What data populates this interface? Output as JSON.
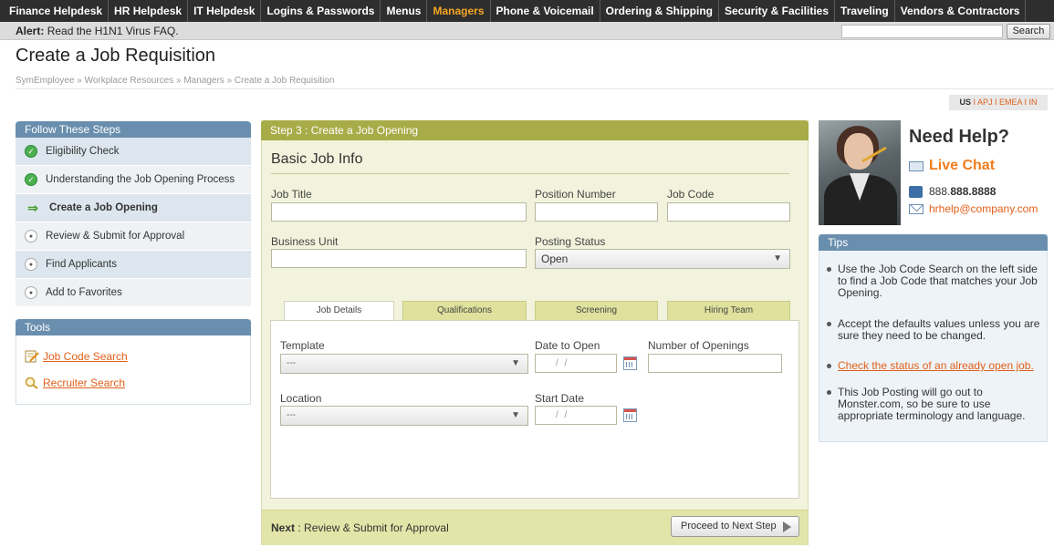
{
  "nav": {
    "items": [
      "Finance Helpdesk",
      "HR Helpdesk",
      "IT Helpdesk",
      "Logins & Passwords",
      "Menus",
      "Managers",
      "Phone & Voicemail",
      "Ordering & Shipping",
      "Security & Facilities",
      "Traveling",
      "Vendors & Contractors"
    ],
    "active_item": "Managers"
  },
  "alert": {
    "label": "Alert:",
    "message": "Read the H1N1 Virus FAQ.",
    "search_button": "Search",
    "search_value": ""
  },
  "page": {
    "title": "Create a Job Requisition",
    "breadcrumb": "SymEmployee » Workplace Resources » Managers » Create a Job Requisition",
    "regions": {
      "current": "US",
      "sep": " I ",
      "others": [
        "APJ",
        "EMEA",
        "IN"
      ]
    }
  },
  "steps": {
    "header": "Follow These Steps",
    "items": [
      {
        "label": "Eligibility Check",
        "state": "done"
      },
      {
        "label": "Understanding the Job Opening Process",
        "state": "done"
      },
      {
        "label": "Create a Job Opening",
        "state": "current"
      },
      {
        "label": "Review & Submit for Approval",
        "state": "todo"
      },
      {
        "label": "Find Applicants",
        "state": "todo"
      },
      {
        "label": "Add to Favorites",
        "state": "todo"
      }
    ]
  },
  "tools": {
    "header": "Tools",
    "job_code_search": "Job Code Search",
    "recruiter_search": "Recruiter Search"
  },
  "form": {
    "step_header": "Step 3 : Create a Job Opening",
    "section_title": "Basic Job Info",
    "job_title_label": "Job Title",
    "position_number_label": "Position Number",
    "job_code_label": "Job Code",
    "business_unit_label": "Business Unit",
    "posting_status_label": "Posting Status",
    "posting_status_value": "Open",
    "tabs": [
      "Job Details",
      "Qualifications",
      "Screening",
      "Hiring Team"
    ],
    "active_tab": "Job Details",
    "template_label": "Template",
    "template_value": "---",
    "date_to_open_label": "Date to Open",
    "date_placeholder": "/ /",
    "number_of_openings_label": "Number of Openings",
    "location_label": "Location",
    "location_value": "---",
    "start_date_label": "Start Date",
    "next_label": "Next",
    "next_text": ": Review & Submit for Approval",
    "proceed_button": "Proceed to Next Step"
  },
  "help": {
    "title": "Need Help?",
    "live_chat": "Live Chat",
    "phone_prefix": "888.",
    "phone_rest": "888.8888",
    "email": "hrhelp@company.com"
  },
  "tips": {
    "header": "Tips",
    "tip1": "Use the Job Code Search on the left side to find a Job Code that matches your Job Opening.",
    "tip2": "Accept the defaults values unless you are sure they need to be changed.",
    "tip3_link": "Check the status of an already open job",
    "tip3_suffix": ".",
    "tip4": "This Job Posting will go out to Monster.com, so be sure to use appropriate terminology and language."
  },
  "colors": {
    "nav_bg": "#2e2e2e",
    "nav_active": "#f6a623",
    "panel_header_blue": "#6a8fae",
    "step_header_olive": "#a8ac48",
    "link_orange": "#e0601a",
    "live_chat_orange": "#f07c1c"
  }
}
